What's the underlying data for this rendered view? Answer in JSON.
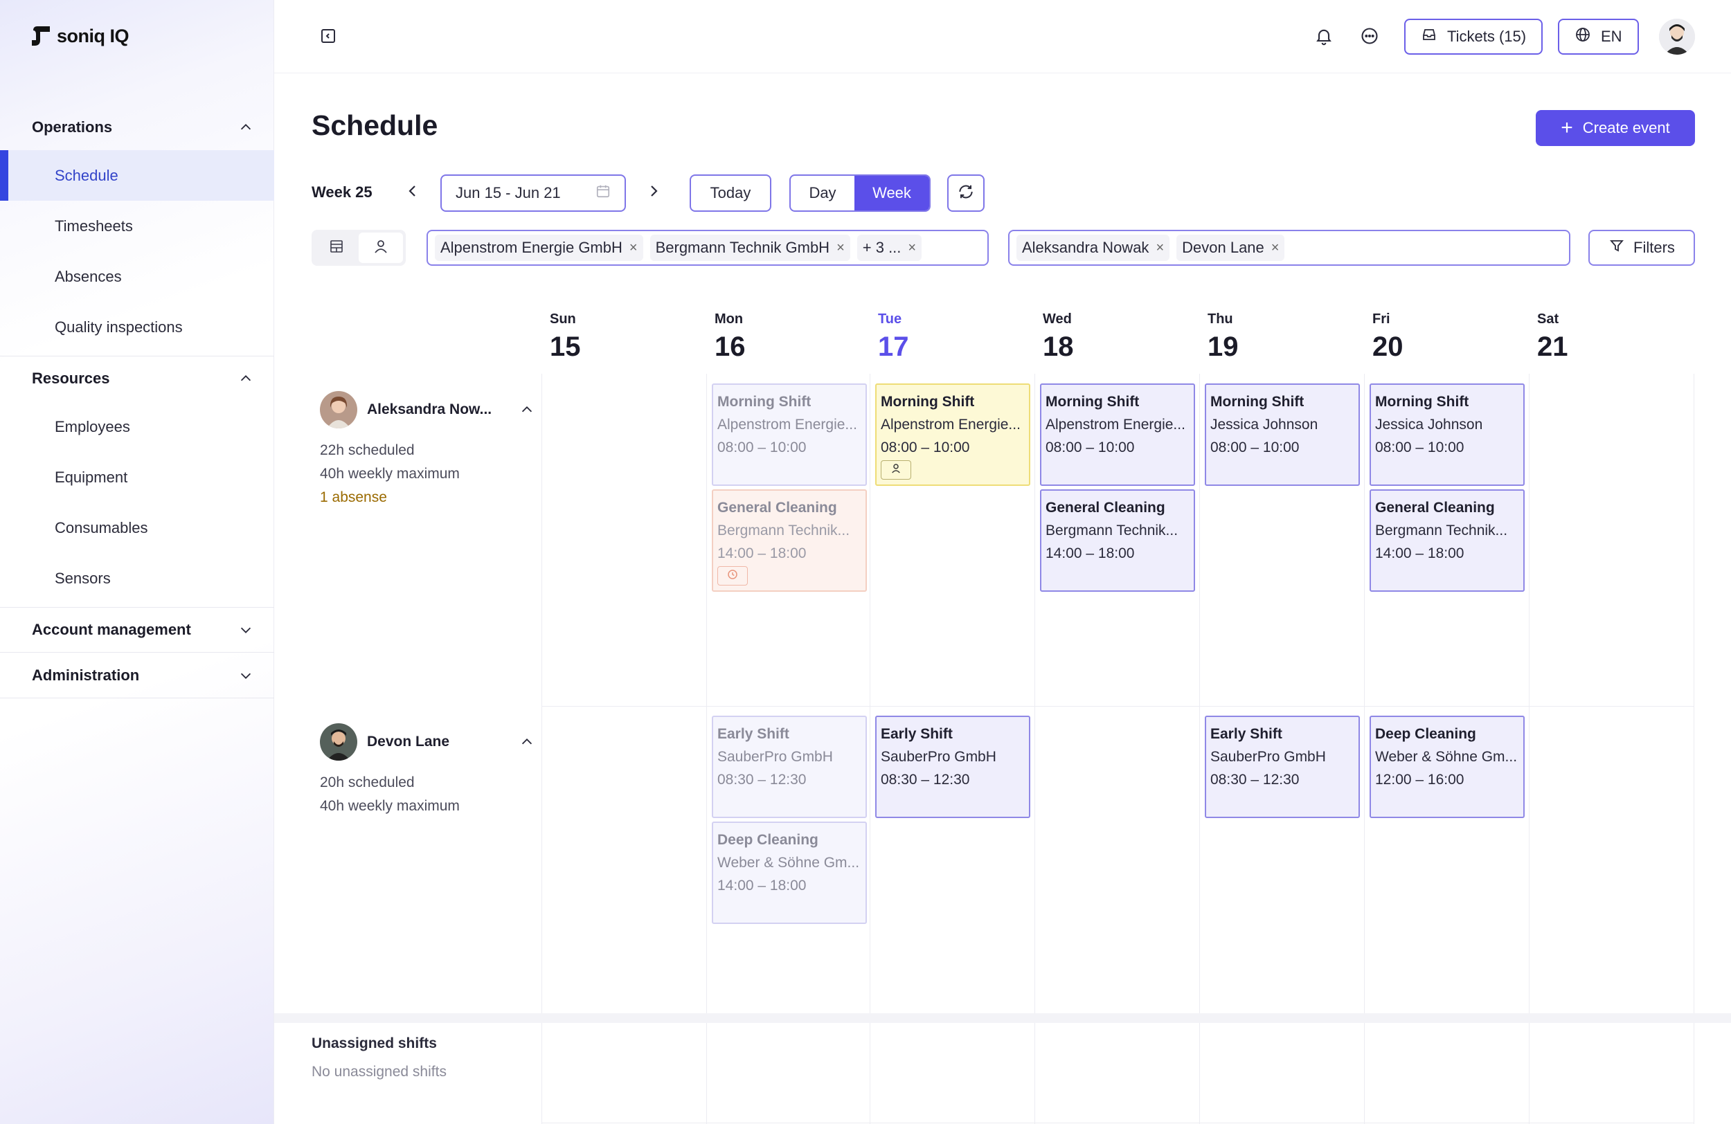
{
  "brand": {
    "name": "soniq IQ"
  },
  "sidebar": {
    "sections": [
      {
        "label": "Operations",
        "expanded": true,
        "items": [
          {
            "label": "Schedule",
            "active": true
          },
          {
            "label": "Timesheets"
          },
          {
            "label": "Absences"
          },
          {
            "label": "Quality inspections"
          }
        ]
      },
      {
        "label": "Resources",
        "expanded": true,
        "items": [
          {
            "label": "Employees"
          },
          {
            "label": "Equipment"
          },
          {
            "label": "Consumables"
          },
          {
            "label": "Sensors"
          }
        ]
      },
      {
        "label": "Account management",
        "expanded": false
      },
      {
        "label": "Administration",
        "expanded": false
      }
    ]
  },
  "topbar": {
    "tickets_label": "Tickets (15)",
    "language": "EN"
  },
  "page": {
    "title": "Schedule",
    "create_label": "Create event"
  },
  "toolbar": {
    "week_label": "Week 25",
    "date_range": "Jun 15 - Jun 21",
    "today_label": "Today",
    "view_day": "Day",
    "view_week": "Week",
    "active_view": "Week"
  },
  "filters": {
    "clients": [
      "Alpenstrom Energie GmbH",
      "Bergmann Technik GmbH",
      "+ 3 ..."
    ],
    "employees": [
      "Aleksandra Nowak",
      "Devon Lane"
    ],
    "filters_label": "Filters"
  },
  "days": [
    {
      "name": "Sun",
      "date": "15"
    },
    {
      "name": "Mon",
      "date": "16"
    },
    {
      "name": "Tue",
      "date": "17",
      "today": true
    },
    {
      "name": "Wed",
      "date": "18"
    },
    {
      "name": "Thu",
      "date": "19"
    },
    {
      "name": "Fri",
      "date": "20"
    },
    {
      "name": "Sat",
      "date": "21"
    }
  ],
  "employees": [
    {
      "name": "Aleksandra Now...",
      "scheduled": "22h scheduled",
      "maximum": "40h weekly maximum",
      "absence": "1 absense",
      "events": [
        {
          "day": 1,
          "slot": 0,
          "title": "Morning Shift",
          "client": "Alpenstrom Energie...",
          "time": "08:00 – 10:00",
          "style": "past"
        },
        {
          "day": 1,
          "slot": 1,
          "title": "General Cleaning",
          "client": "Bergmann Technik...",
          "time": "14:00 – 18:00",
          "style": "warn",
          "badge": "clock-icon"
        },
        {
          "day": 2,
          "slot": 0,
          "title": "Morning Shift",
          "client": "Alpenstrom Energie...",
          "time": "08:00 – 10:00",
          "style": "yellow",
          "badge": "user-icon"
        },
        {
          "day": 3,
          "slot": 0,
          "title": "Morning Shift",
          "client": "Alpenstrom Energie...",
          "time": "08:00 – 10:00",
          "style": "normal"
        },
        {
          "day": 3,
          "slot": 1,
          "title": "General Cleaning",
          "client": "Bergmann Technik...",
          "time": "14:00 – 18:00",
          "style": "normal"
        },
        {
          "day": 4,
          "slot": 0,
          "title": "Morning Shift",
          "client": "Jessica Johnson",
          "time": "08:00 – 10:00",
          "style": "normal"
        },
        {
          "day": 5,
          "slot": 0,
          "title": "Morning Shift",
          "client": "Jessica Johnson",
          "time": "08:00 – 10:00",
          "style": "normal"
        },
        {
          "day": 5,
          "slot": 1,
          "title": "General Cleaning",
          "client": "Bergmann Technik...",
          "time": "14:00 – 18:00",
          "style": "normal"
        }
      ]
    },
    {
      "name": "Devon Lane",
      "scheduled": "20h scheduled",
      "maximum": "40h weekly maximum",
      "absence": "",
      "events": [
        {
          "day": 1,
          "slot": 0,
          "title": "Early Shift",
          "client": "SauberPro GmbH",
          "time": "08:30 – 12:30",
          "style": "past"
        },
        {
          "day": 1,
          "slot": 1,
          "title": "Deep Cleaning",
          "client": "Weber & Söhne Gm...",
          "time": "14:00 – 18:00",
          "style": "past"
        },
        {
          "day": 2,
          "slot": 0,
          "title": "Early Shift",
          "client": "SauberPro GmbH",
          "time": "08:30 – 12:30",
          "style": "normal"
        },
        {
          "day": 4,
          "slot": 0,
          "title": "Early Shift",
          "client": "SauberPro GmbH",
          "time": "08:30 – 12:30",
          "style": "normal"
        },
        {
          "day": 5,
          "slot": 0,
          "title": "Deep Cleaning",
          "client": "Weber & Söhne Gm...",
          "time": "12:00 – 16:00",
          "style": "normal"
        }
      ]
    }
  ],
  "unassigned": {
    "title": "Unassigned shifts",
    "empty": "No unassigned shifts"
  }
}
